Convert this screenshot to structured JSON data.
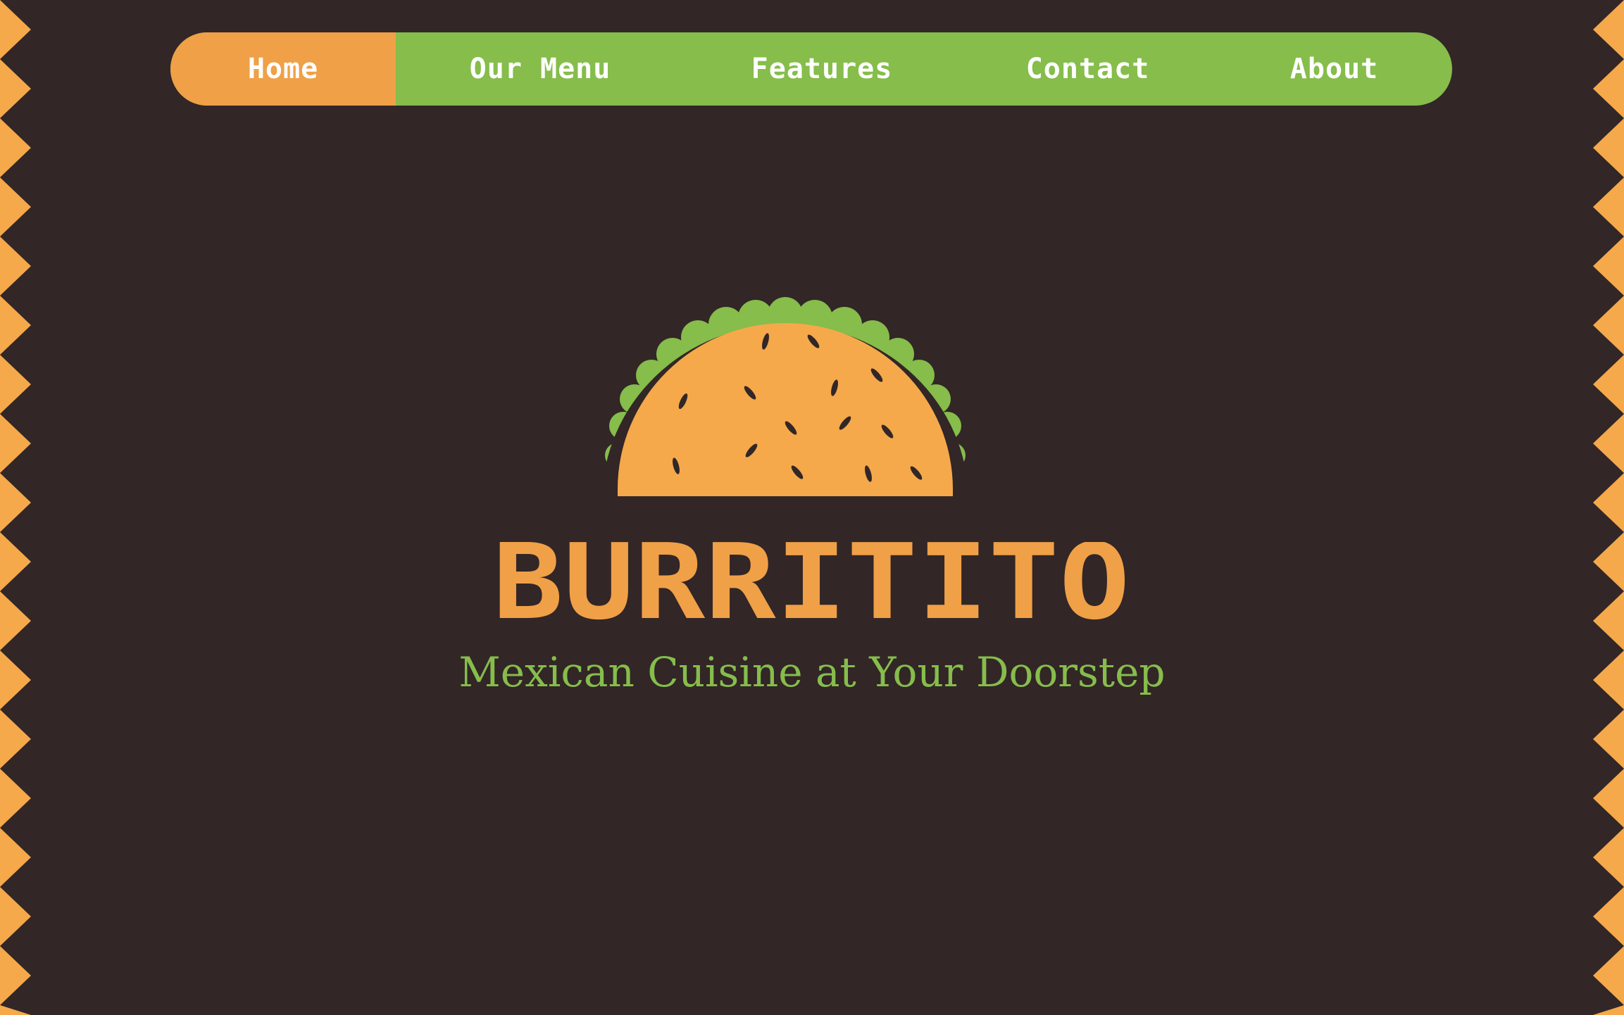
{
  "nav": {
    "items": [
      {
        "label": "Home",
        "active": true
      },
      {
        "label": "Our Menu",
        "active": false
      },
      {
        "label": "Features",
        "active": false
      },
      {
        "label": "Contact",
        "active": false
      },
      {
        "label": "About",
        "active": false
      }
    ]
  },
  "hero": {
    "brand_name": "BURRITITO",
    "tagline": "Mexican Cuisine at Your Doorstep",
    "logo_icon": "taco-icon"
  },
  "colors": {
    "background": "#322627",
    "accent_orange": "#f0a047",
    "accent_green": "#86bd4b",
    "text_light": "#ffffff"
  }
}
